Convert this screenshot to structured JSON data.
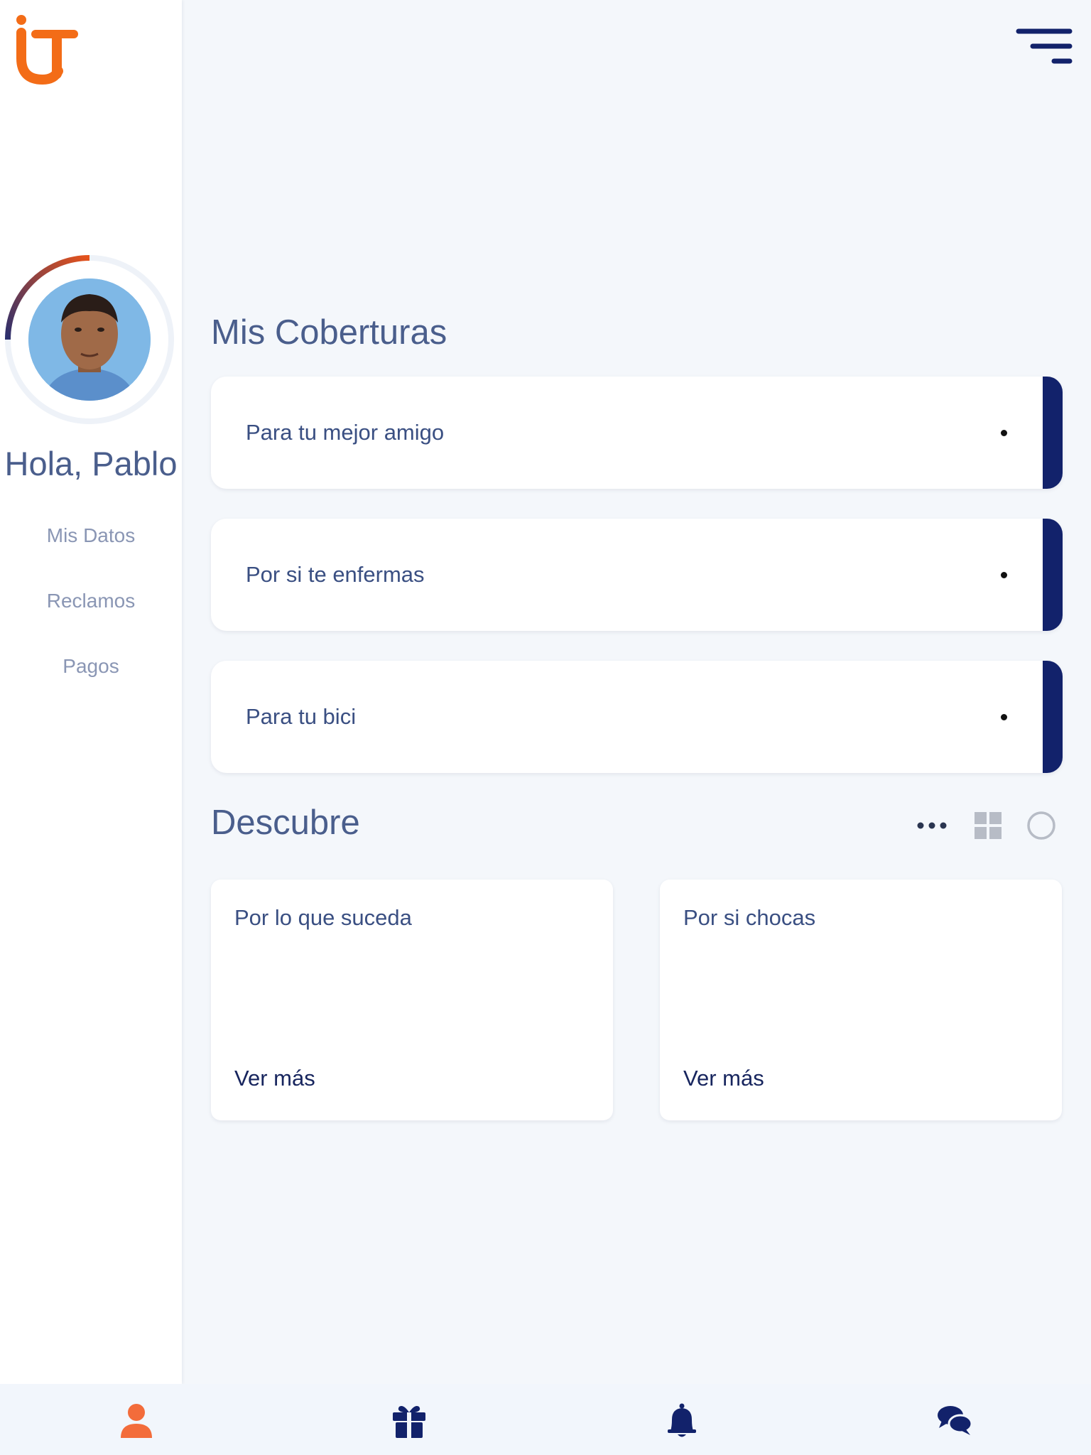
{
  "app": {
    "logo_icon": "brand-logo",
    "brand_color": "#f36c17"
  },
  "sidebar": {
    "greeting": "Hola, Pablo",
    "items": [
      {
        "label": "Mis Datos"
      },
      {
        "label": "Reclamos"
      },
      {
        "label": "Pagos"
      }
    ]
  },
  "header": {
    "menu_icon": "menu-icon"
  },
  "coverages": {
    "title": "Mis Coberturas",
    "items": [
      {
        "label": "Para tu mejor amigo"
      },
      {
        "label": "Por si te enfermas"
      },
      {
        "label": "Para tu bici"
      }
    ],
    "accent_color": "#12226b"
  },
  "discover": {
    "title": "Descubre",
    "cards": [
      {
        "title": "Por lo que suceda",
        "link": "Ver más"
      },
      {
        "title": "Por si chocas",
        "link": "Ver más"
      }
    ]
  },
  "bottom_nav": {
    "items": [
      {
        "icon": "user-icon",
        "active": true
      },
      {
        "icon": "gift-icon"
      },
      {
        "icon": "bell-icon"
      },
      {
        "icon": "chat-icon"
      }
    ],
    "active_color": "#f36c3b",
    "inactive_color": "#12226b"
  }
}
